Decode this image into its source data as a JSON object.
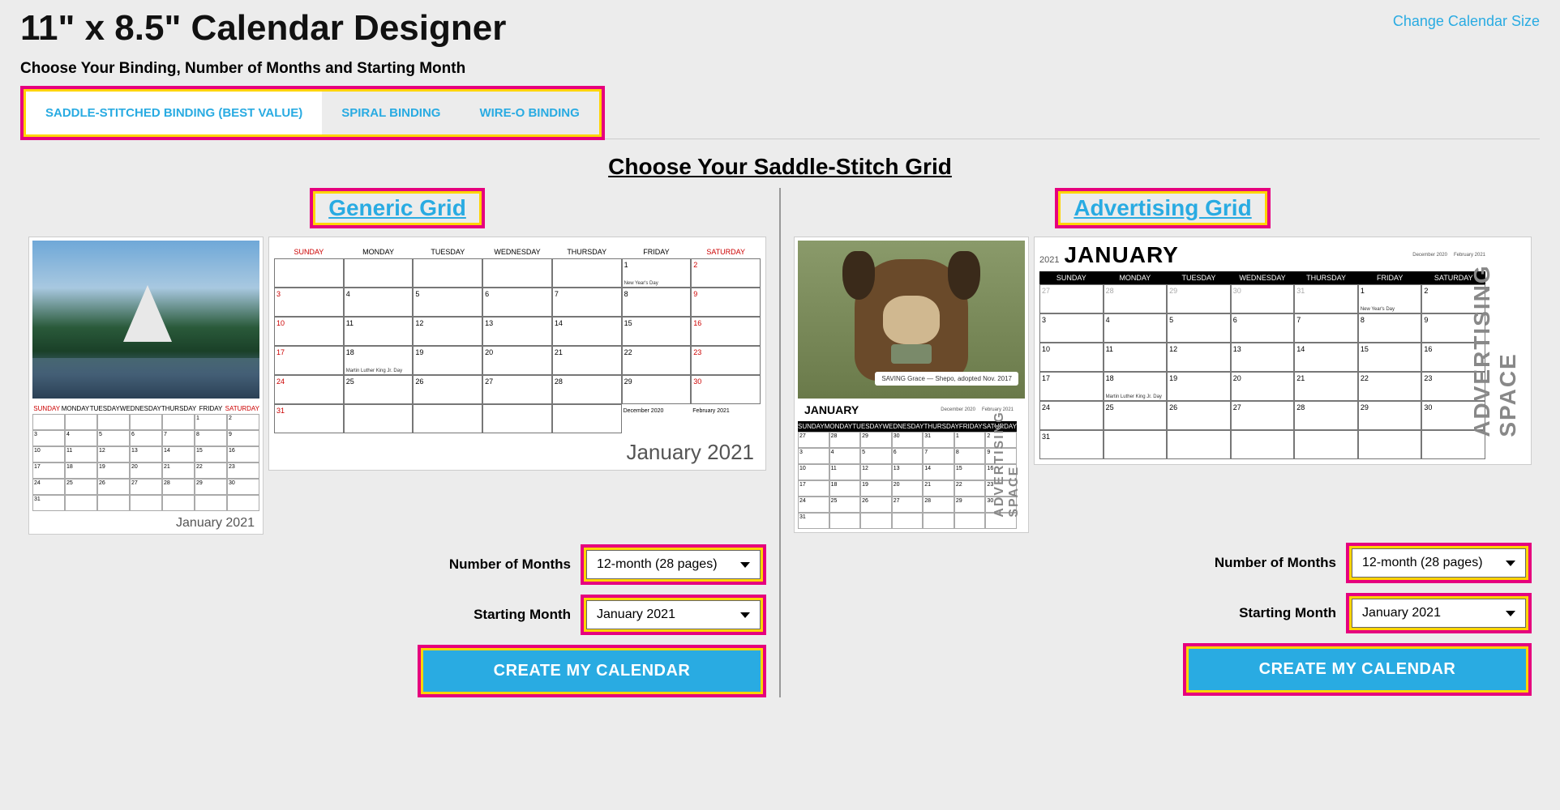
{
  "header": {
    "title": "11\" x 8.5\" Calendar Designer",
    "change_link": "Change Calendar Size"
  },
  "subtitle": "Choose Your Binding, Number of Months and Starting Month",
  "tabs": {
    "saddle": "SADDLE-STITCHED BINDING (BEST VALUE)",
    "spiral": "SPIRAL BINDING",
    "wireo": "WIRE-O BINDING"
  },
  "section_title": "Choose Your Saddle-Stitch Grid",
  "grids": {
    "generic": {
      "title": "Generic Grid"
    },
    "advertising": {
      "title": "Advertising Grid"
    }
  },
  "days": {
    "sun": "SUNDAY",
    "mon": "MONDAY",
    "tue": "TUESDAY",
    "wed": "WEDNESDAY",
    "thu": "THURSDAY",
    "fri": "FRIDAY",
    "sat": "SATURDAY"
  },
  "preview": {
    "mini_label": "January 2021",
    "large_label": "January 2021",
    "month_black": "JANUARY",
    "year": "2021",
    "prev_month": "December 2020",
    "next_month": "February 2021",
    "ad_space": "ADVERTISING SPACE",
    "saving_grace": "SAVING Grace — Shepo, adopted Nov. 2017",
    "ny_day": "New Year's Day",
    "mlk": "Martin Luther King Jr. Day"
  },
  "controls": {
    "months_label": "Number of Months",
    "months_value": "12-month (28 pages)",
    "start_label": "Starting Month",
    "start_value": "January   2021",
    "create": "CREATE MY CALENDAR"
  }
}
